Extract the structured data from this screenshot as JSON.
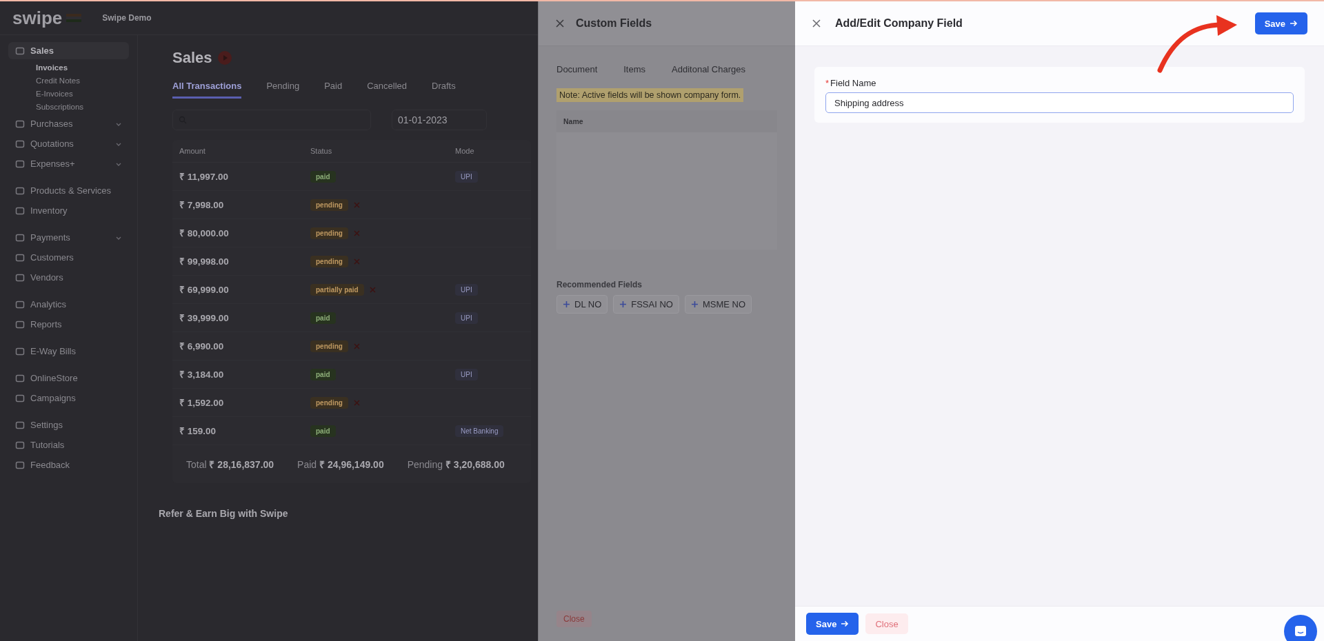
{
  "header": {
    "logo": "swipe",
    "company": "Swipe Demo"
  },
  "sidebar": {
    "groups": [
      [
        {
          "label": "Sales",
          "selected": true,
          "children": [
            {
              "label": "Invoices",
              "selected": true
            },
            {
              "label": "Credit Notes",
              "selected": false
            },
            {
              "label": "E-Invoices",
              "selected": false
            },
            {
              "label": "Subscriptions",
              "selected": false
            }
          ]
        },
        {
          "label": "Purchases",
          "selected": false,
          "expandable": true
        },
        {
          "label": "Quotations",
          "selected": false,
          "expandable": true
        },
        {
          "label": "Expenses+",
          "selected": false,
          "expandable": true
        }
      ],
      [
        {
          "label": "Products & Services",
          "selected": false
        },
        {
          "label": "Inventory",
          "selected": false
        }
      ],
      [
        {
          "label": "Payments",
          "selected": false,
          "expandable": true
        },
        {
          "label": "Customers",
          "selected": false
        },
        {
          "label": "Vendors",
          "selected": false
        }
      ],
      [
        {
          "label": "Analytics",
          "selected": false
        },
        {
          "label": "Reports",
          "selected": false
        }
      ],
      [
        {
          "label": "E-Way Bills",
          "selected": false
        }
      ],
      [
        {
          "label": "OnlineStore",
          "selected": false
        },
        {
          "label": "Campaigns",
          "selected": false
        }
      ],
      [
        {
          "label": "Settings",
          "selected": false
        },
        {
          "label": "Tutorials",
          "selected": false
        },
        {
          "label": "Feedback",
          "selected": false
        }
      ]
    ]
  },
  "sales": {
    "title": "Sales",
    "tabs": [
      {
        "label": "All Transactions",
        "selected": true
      },
      {
        "label": "Pending",
        "selected": false
      },
      {
        "label": "Paid",
        "selected": false
      },
      {
        "label": "Cancelled",
        "selected": false
      },
      {
        "label": "Drafts",
        "selected": false
      }
    ],
    "date": "01-01-2023",
    "table": {
      "columns": [
        "Amount",
        "Status",
        "Mode"
      ],
      "rows": [
        {
          "amount": "₹ 11,997.00",
          "status": "paid",
          "kind": "paid",
          "mode": "UPI"
        },
        {
          "amount": "₹ 7,998.00",
          "status": "pending",
          "kind": "pending"
        },
        {
          "amount": "₹ 80,000.00",
          "status": "pending",
          "kind": "pending"
        },
        {
          "amount": "₹ 99,998.00",
          "status": "pending",
          "kind": "pending"
        },
        {
          "amount": "₹ 69,999.00",
          "status": "partially paid",
          "kind": "pending",
          "mode": "UPI"
        },
        {
          "amount": "₹ 39,999.00",
          "status": "paid",
          "kind": "paid",
          "mode": "UPI"
        },
        {
          "amount": "₹ 6,990.00",
          "status": "pending",
          "kind": "pending"
        },
        {
          "amount": "₹ 3,184.00",
          "status": "paid",
          "kind": "paid",
          "mode": "UPI"
        },
        {
          "amount": "₹ 1,592.00",
          "status": "pending",
          "kind": "pending"
        },
        {
          "amount": "₹ 159.00",
          "status": "paid",
          "kind": "paid",
          "mode": "Net Banking"
        }
      ]
    },
    "totals": [
      {
        "label": "Total",
        "value": "₹ 28,16,837.00"
      },
      {
        "label": "Paid",
        "value": "₹ 24,96,149.00"
      },
      {
        "label": "Pending",
        "value": "₹ 3,20,688.00"
      }
    ],
    "refer": {
      "title": "Refer & Earn Big with Swipe"
    }
  },
  "custom_fields": {
    "title": "Custom Fields",
    "tabs": [
      "Document",
      "Items",
      "Additonal Charges"
    ],
    "note": "Note: Active fields will be shown company form.",
    "columns": [
      "Name"
    ],
    "recommended_title": "Recommended Fields",
    "recommended": [
      "DL NO",
      "FSSAI NO",
      "MSME NO"
    ],
    "close": "Close"
  },
  "editor": {
    "title": "Add/Edit Company Field",
    "save": "Save",
    "field": {
      "label": "Field Name",
      "required_mark": "*",
      "value": "Shipping address"
    },
    "footer": {
      "save": "Save",
      "close": "Close"
    }
  }
}
